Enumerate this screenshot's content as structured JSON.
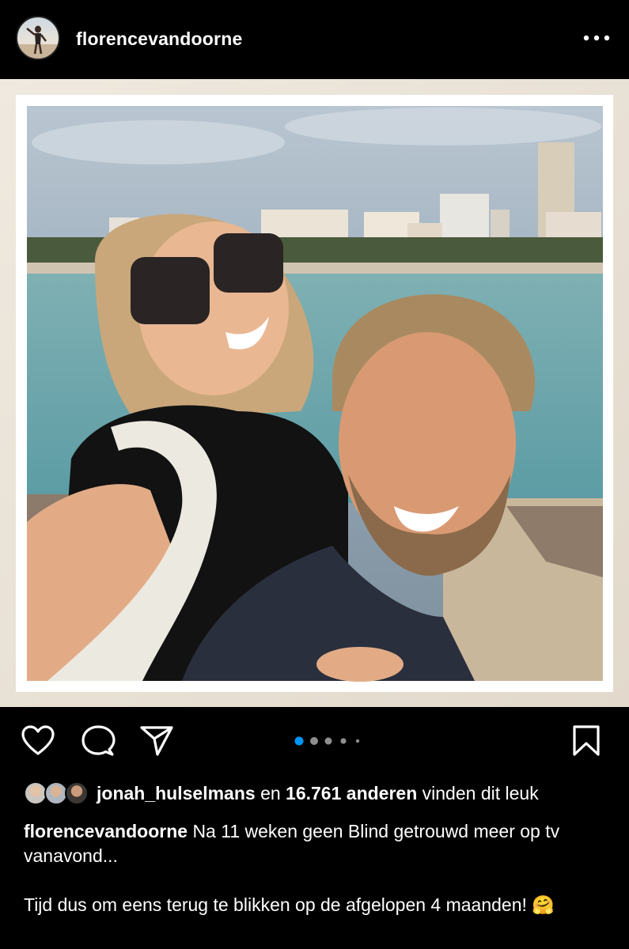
{
  "post": {
    "username": "florencevandoorne",
    "avatar_icon": "profile-photo",
    "more_icon": "more-horizontal-icon"
  },
  "actions": {
    "like_icon": "heart-icon",
    "comment_icon": "comment-icon",
    "share_icon": "send-icon",
    "save_icon": "bookmark-icon",
    "carousel": {
      "total": 5,
      "active": 1
    }
  },
  "likes": {
    "user": "jonah_hulselmans",
    "connector": "en",
    "count": "16.761 anderen",
    "suffix": "vinden dit leuk"
  },
  "caption": {
    "username": "florencevandoorne",
    "line1": "Na 11 weken geen Blind getrouwd meer op tv vanavond...",
    "line2": "Tijd dus om eens terug te blikken op de afgelopen 4 maanden! 🤗"
  },
  "colors": {
    "background": "#000000",
    "text": "#ffffff",
    "accent": "#0095f6",
    "frame": "#ece6dc"
  }
}
